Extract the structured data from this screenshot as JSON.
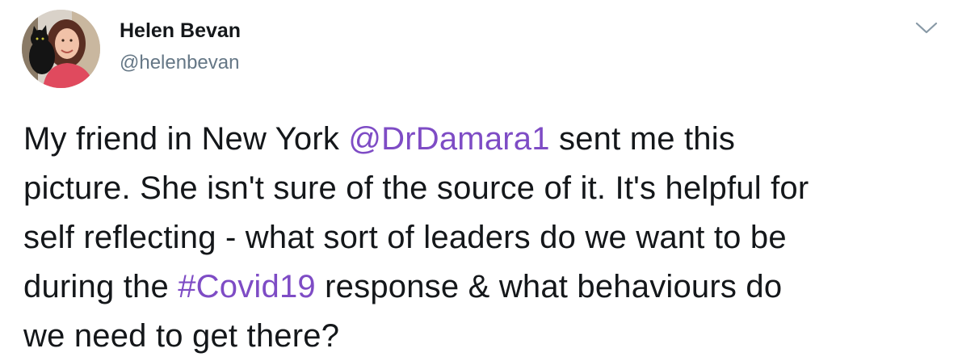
{
  "author": {
    "name": "Helen Bevan",
    "handle": "@helenbevan"
  },
  "tweet": {
    "line1": {
      "before": "My friend in New York ",
      "mention": "@DrDamara1",
      "after": " sent me this"
    },
    "line2": "picture. She isn't sure of the source of it. It's helpful for",
    "line3": "self reflecting - what sort of leaders do we want to be",
    "line4": {
      "before": "during the ",
      "hashtag": "#Covid19",
      "after": " response & what behaviours do"
    },
    "line5": "we need to get there?"
  },
  "icons": {
    "menu": "chevron-down-icon"
  },
  "colors": {
    "link": "#7e4cc5",
    "handle": "#657786",
    "text": "#14171a"
  }
}
